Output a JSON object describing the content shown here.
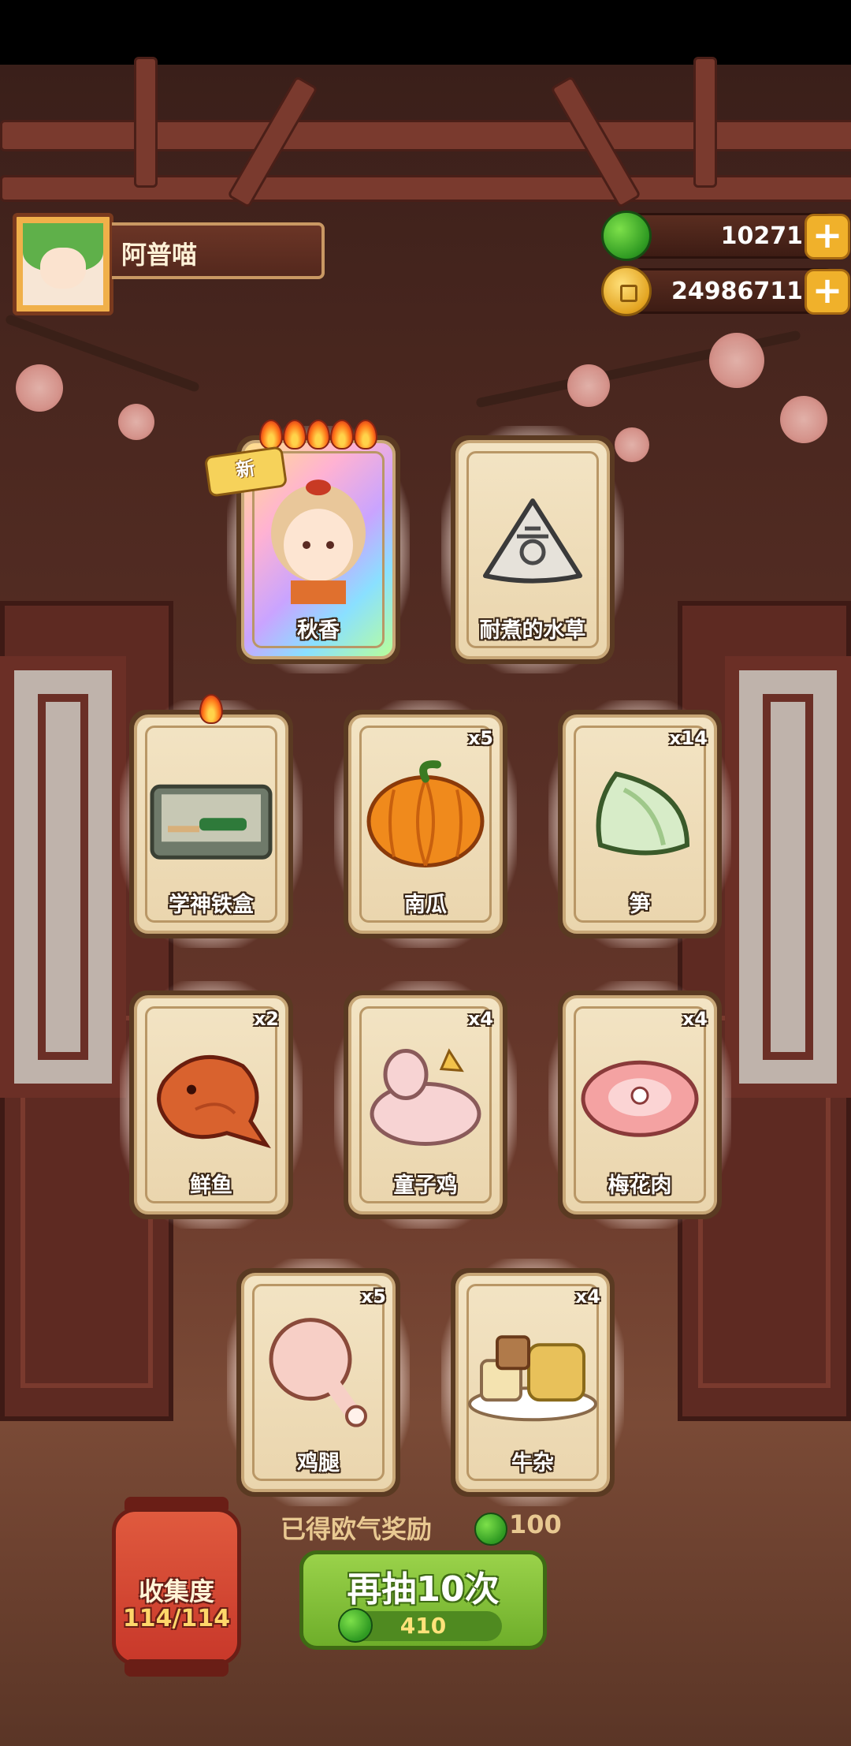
{
  "player": {
    "name": "阿普喵"
  },
  "currency": {
    "apples": "10271",
    "coins": "24986711",
    "plus_symbol": "+"
  },
  "new_badge": "新",
  "cards": [
    {
      "label": "秋香",
      "count": "",
      "flames": 5,
      "is_new": true,
      "rare": true
    },
    {
      "label": "耐煮的水草",
      "count": "",
      "flames": 0
    },
    {
      "label": "学神铁盒",
      "count": "",
      "flames": 1
    },
    {
      "label": "南瓜",
      "count": "x5",
      "flames": 0
    },
    {
      "label": "笋",
      "count": "x14",
      "flames": 0
    },
    {
      "label": "鲜鱼",
      "count": "x2",
      "flames": 0
    },
    {
      "label": "童子鸡",
      "count": "x4",
      "flames": 0
    },
    {
      "label": "梅花肉",
      "count": "x4",
      "flames": 0
    },
    {
      "label": "鸡腿",
      "count": "x5",
      "flames": 0
    },
    {
      "label": "牛杂",
      "count": "x4",
      "flames": 0
    }
  ],
  "bonus": {
    "text": "已得欧气奖励",
    "amount": "100"
  },
  "collection": {
    "title": "收集度",
    "value": "114/114"
  },
  "draw": {
    "label": "再抽10次",
    "cost": "410"
  },
  "colors": {
    "card_bg": "#ead5ad",
    "button_green": "#7cbb33",
    "lantern_red": "#d0412f"
  }
}
